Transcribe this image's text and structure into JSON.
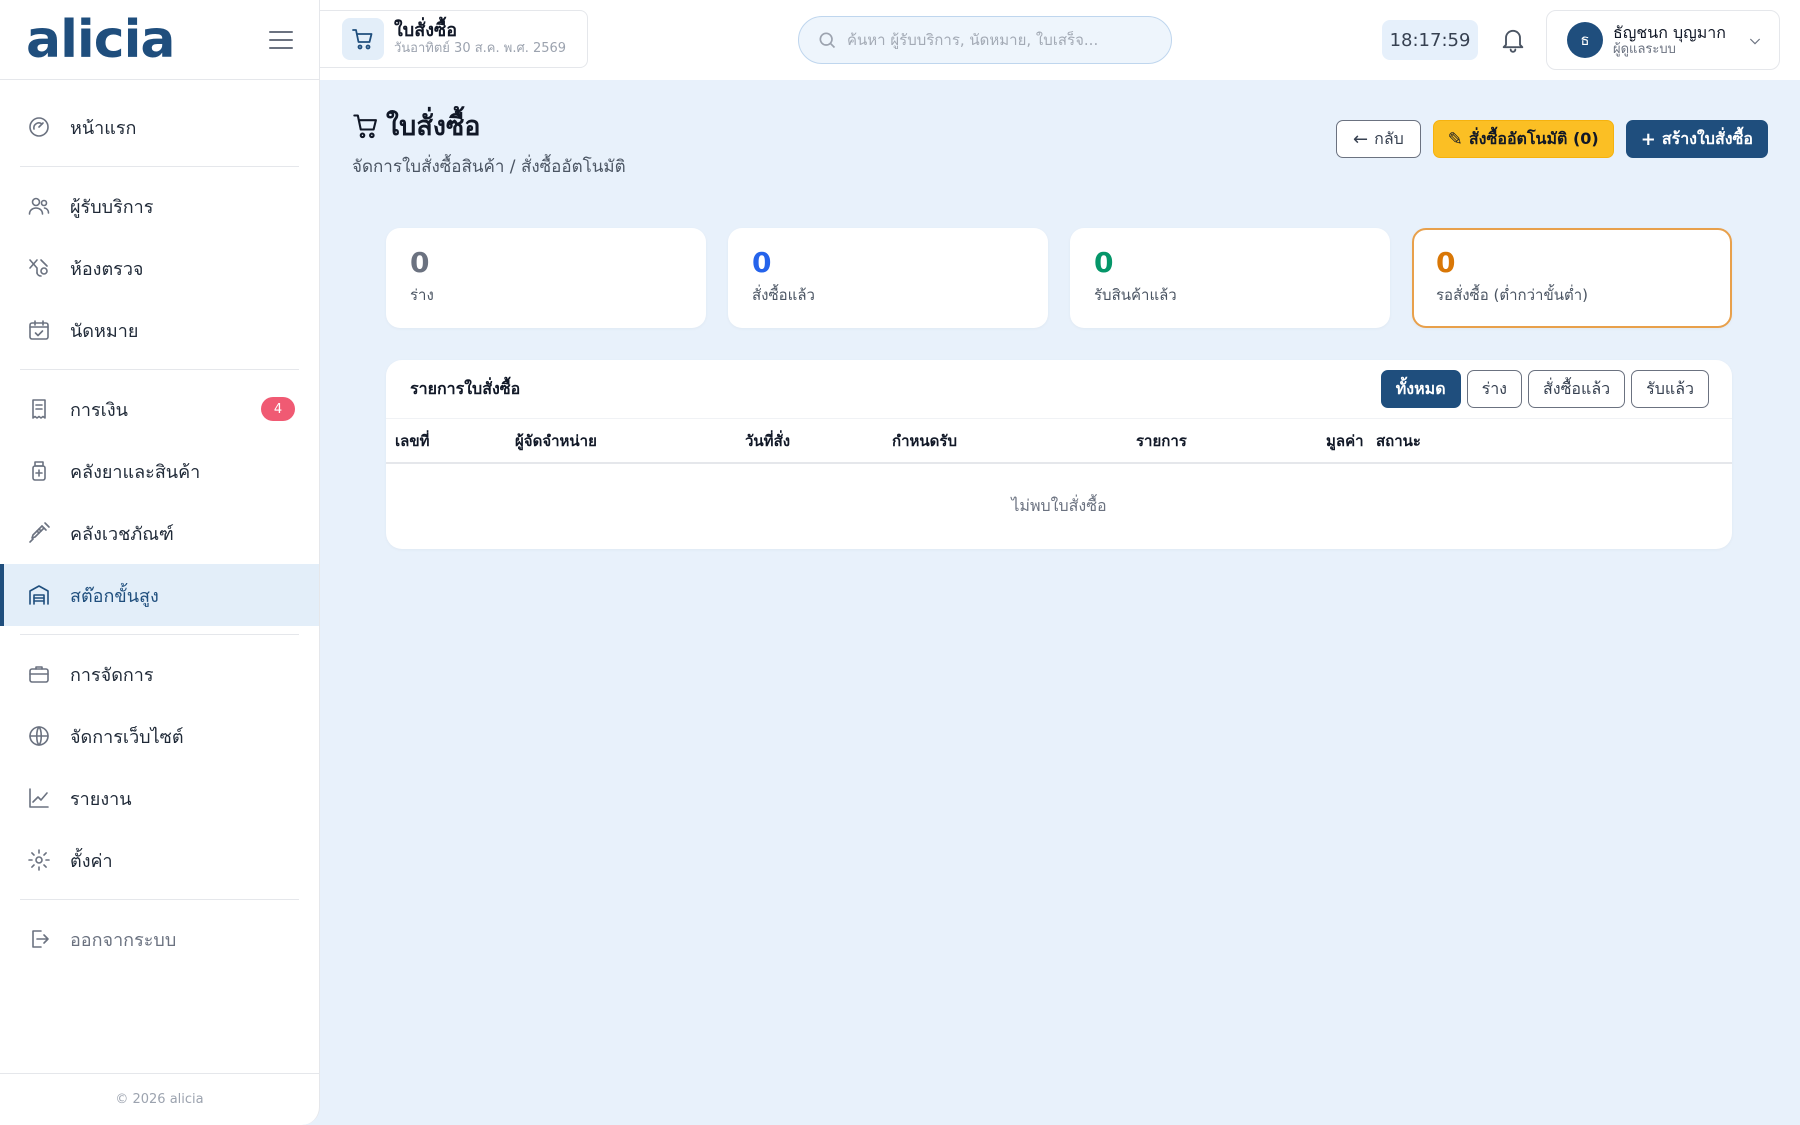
{
  "brand": {
    "name": "alicia"
  },
  "sidebar": {
    "items": [
      {
        "label": "หน้าแรก",
        "icon": "dashboard-gauge-icon"
      },
      {
        "label": "ผู้รับบริการ",
        "icon": "users-icon"
      },
      {
        "label": "ห้องตรวจ",
        "icon": "stethoscope-icon"
      },
      {
        "label": "นัดหมาย",
        "icon": "calendar-check-icon"
      },
      {
        "label": "การเงิน",
        "icon": "receipt-icon",
        "badge": "4"
      },
      {
        "label": "คลังยาและสินค้า",
        "icon": "medicine-bottle-icon"
      },
      {
        "label": "คลังเวชภัณฑ์",
        "icon": "syringe-icon"
      },
      {
        "label": "สต๊อกขั้นสูง",
        "icon": "warehouse-icon",
        "active": true
      },
      {
        "label": "การจัดการ",
        "icon": "briefcase-icon"
      },
      {
        "label": "จัดการเว็บไซต์",
        "icon": "globe-icon"
      },
      {
        "label": "รายงาน",
        "icon": "chart-line-icon"
      },
      {
        "label": "ตั้งค่า",
        "icon": "gear-icon"
      },
      {
        "label": "ออกจากระบบ",
        "icon": "logout-icon"
      }
    ],
    "footer": "© 2026 alicia"
  },
  "topbar": {
    "page_title": "ใบสั่งซื้อ",
    "page_date": "วันอาทิตย์ 30 ส.ค. พ.ศ. 2569",
    "search_placeholder": "ค้นหา ผู้รับบริการ, นัดหมาย, ใบเสร็จ...",
    "clock": "18:17:59",
    "user": {
      "initial": "ธ",
      "name": "ธัญชนก บุญมาก",
      "role": "ผู้ดูแลระบบ"
    }
  },
  "page": {
    "title": "ใบสั่งซื้อ",
    "breadcrumb": "จัดการใบสั่งซื้อสินค้า / สั่งซื้ออัตโนมัติ",
    "actions": {
      "back": "กลับ",
      "auto_order": "สั่งซื้ออัตโนมัติ (0)",
      "create": "สร้างใบสั่งซื้อ"
    }
  },
  "stats": [
    {
      "value": "0",
      "label": "ร่าง",
      "color": "#6b7280"
    },
    {
      "value": "0",
      "label": "สั่งซื้อแล้ว",
      "color": "#2563eb"
    },
    {
      "value": "0",
      "label": "รับสินค้าแล้ว",
      "color": "#059669"
    },
    {
      "value": "0",
      "label": "รอสั่งซื้อ (ต่ำกว่าขั้นต่ำ)",
      "color": "#d97706"
    }
  ],
  "orders": {
    "title": "รายการใบสั่งซื้อ",
    "filters": [
      "ทั้งหมด",
      "ร่าง",
      "สั่งซื้อแล้ว",
      "รับแล้ว"
    ],
    "active_filter": "ทั้งหมด",
    "columns": [
      "เลขที่",
      "ผู้จัดจำหน่าย",
      "วันที่สั่ง",
      "กำหนดรับ",
      "รายการ",
      "มูลค่า",
      "สถานะ"
    ],
    "rows": [],
    "empty_text": "ไม่พบใบสั่งซื้อ"
  },
  "colors": {
    "primary": "#1f4e7d",
    "accent": "#fbbf24",
    "badge": "#f05a73",
    "background": "#e8f1fb"
  }
}
